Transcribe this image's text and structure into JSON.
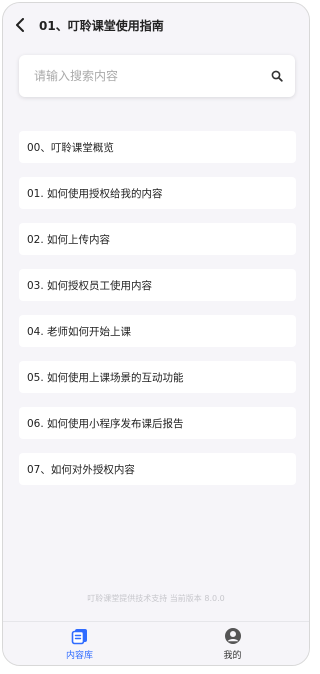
{
  "header": {
    "title": "01、叮聆课堂使用指南"
  },
  "search": {
    "placeholder": "请输入搜索内容"
  },
  "items": [
    {
      "label": "00、叮聆课堂概览"
    },
    {
      "label": "01. 如何使用授权给我的内容"
    },
    {
      "label": "02. 如何上传内容"
    },
    {
      "label": "03. 如何授权员工使用内容"
    },
    {
      "label": "04. 老师如何开始上课"
    },
    {
      "label": "05. 如何使用上课场景的互动功能"
    },
    {
      "label": "06. 如何使用小程序发布课后报告"
    },
    {
      "label": "07、如何对外授权内容"
    }
  ],
  "footer": {
    "text": "叮聆课堂提供技术支持 当前版本 8.0.0"
  },
  "tabbar": {
    "tabs": [
      {
        "label": "内容库",
        "icon": "library-icon",
        "active": true
      },
      {
        "label": "我的",
        "icon": "user-icon",
        "active": false
      }
    ]
  },
  "colors": {
    "accent": "#2f6bff",
    "background": "#f6f5f9"
  }
}
